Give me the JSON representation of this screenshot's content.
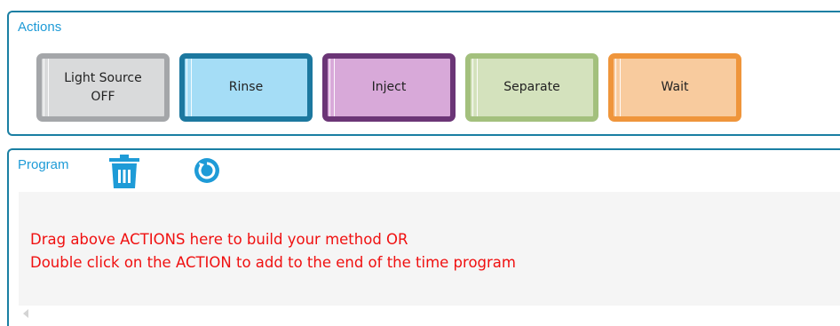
{
  "actions": {
    "title": "Actions",
    "buttons": [
      {
        "id": "light_source",
        "label_line1": "Light Source",
        "label_line2": "OFF",
        "color": "#a4a6a9",
        "fill": "#d9dadb"
      },
      {
        "id": "rinse",
        "label": "Rinse",
        "color": "#1c789f",
        "fill": "#a5ddf6"
      },
      {
        "id": "inject",
        "label": "Inject",
        "color": "#6b3576",
        "fill": "#d8a9d9"
      },
      {
        "id": "separate",
        "label": "Separate",
        "color": "#a3c07d",
        "fill": "#d4e2bd"
      },
      {
        "id": "wait",
        "label": "Wait",
        "color": "#ef953b",
        "fill": "#f8cb9e"
      }
    ]
  },
  "program": {
    "title": "Program",
    "trash_icon": "trash-icon",
    "refresh_icon": "refresh-icon",
    "message_line1": "Drag above ACTIONS here to build your method OR",
    "message_line2": "Double click on the ACTION to add to the end of the time program"
  },
  "colors": {
    "panel_border": "#1a7fa3",
    "title": "#1e9bd7",
    "icon": "#1e9bd7",
    "message": "#f01010"
  }
}
